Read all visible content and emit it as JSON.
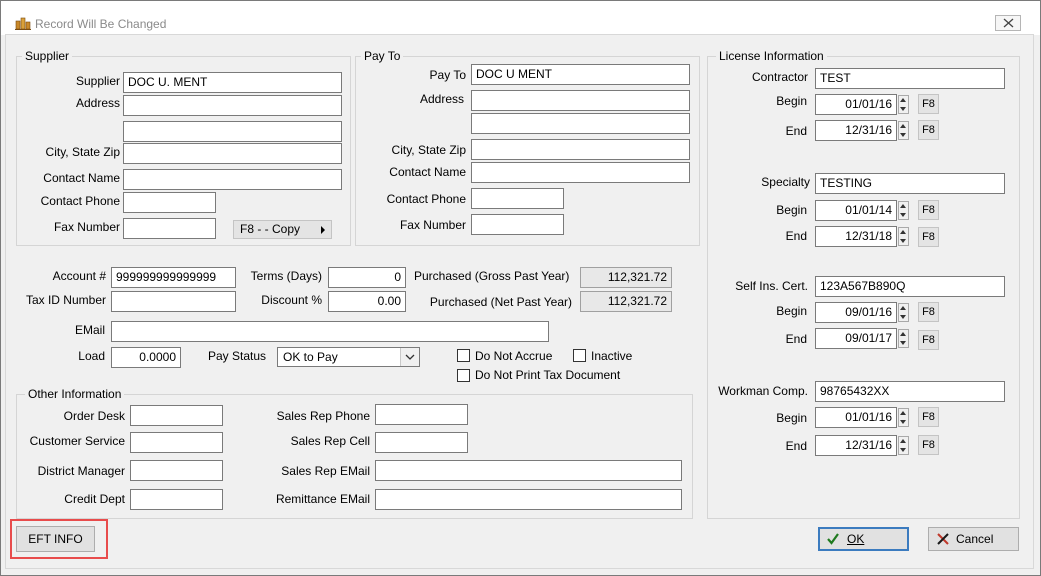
{
  "window": {
    "title": "Record Will Be Changed"
  },
  "supplier": {
    "legend": "Supplier",
    "supplier_label": "Supplier",
    "supplier_value": "DOC U. MENT",
    "address_label": "Address",
    "address1": "",
    "address2": "",
    "city_label": "City, State  Zip",
    "city_value": "",
    "contact_name_label": "Contact Name",
    "contact_name_value": "",
    "contact_phone_label": "Contact Phone",
    "contact_phone_value": "",
    "fax_label": "Fax Number",
    "fax_value": "",
    "copy_button": "F8 - - Copy"
  },
  "payto": {
    "legend": "Pay To",
    "payto_label": "Pay To",
    "payto_value": "DOC U MENT",
    "address_label": "Address",
    "address1": "",
    "address2": "",
    "city_label": "City, State  Zip",
    "city_value": "",
    "contact_name_label": "Contact Name",
    "contact_name_value": "",
    "contact_phone_label": "Contact Phone",
    "contact_phone_value": "",
    "fax_label": "Fax Number",
    "fax_value": ""
  },
  "account": {
    "account_label": "Account #",
    "account_value": "999999999999999",
    "taxid_label": "Tax ID Number",
    "taxid_value": "",
    "terms_label": "Terms (Days)",
    "terms_value": "0",
    "discount_label": "Discount %",
    "discount_value": "0.00",
    "gross_label": "Purchased (Gross Past Year)",
    "gross_value": "112,321.72",
    "net_label": "Purchased (Net Past Year)",
    "net_value": "112,321.72",
    "email_label": "EMail",
    "email_value": "",
    "load_label": "Load",
    "load_value": "0.0000",
    "paystatus_label": "Pay Status",
    "paystatus_value": "OK to Pay",
    "not_accrue_label": "Do Not Accrue",
    "inactive_label": "Inactive",
    "not_print_label": "Do Not Print Tax Document"
  },
  "other": {
    "legend": "Other Information",
    "order_desk_label": "Order Desk",
    "order_desk_value": "",
    "customer_service_label": "Customer Service",
    "customer_service_value": "",
    "district_manager_label": "District Manager",
    "district_manager_value": "",
    "credit_dept_label": "Credit Dept",
    "credit_dept_value": "",
    "sales_rep_phone_label": "Sales Rep Phone",
    "sales_rep_phone_value": "",
    "sales_rep_cell_label": "Sales Rep Cell",
    "sales_rep_cell_value": "",
    "sales_rep_email_label": "Sales Rep EMail",
    "sales_rep_email_value": "",
    "remittance_email_label": "Remittance EMail",
    "remittance_email_value": ""
  },
  "license": {
    "legend": "License Information",
    "begin_label": "Begin",
    "end_label": "End",
    "f8_label": "F8",
    "contractor_label": "Contractor",
    "contractor_value": "TEST",
    "contractor_begin": "01/01/16",
    "contractor_end": "12/31/16",
    "specialty_label": "Specialty",
    "specialty_value": "TESTING",
    "specialty_begin": "01/01/14",
    "specialty_end": "12/31/18",
    "selfins_label": "Self Ins. Cert.",
    "selfins_value": "123A567B890Q",
    "selfins_begin": "09/01/16",
    "selfins_end": "09/01/17",
    "workman_label": "Workman Comp.",
    "workman_value": "98765432XX",
    "workman_begin": "01/01/16",
    "workman_end": "12/31/16"
  },
  "buttons": {
    "eft": "EFT INFO",
    "ok": "OK",
    "cancel": "Cancel"
  },
  "colors": {
    "highlight": "#e84c4c",
    "ok_check": "#1f7a1f",
    "cancel_x": "#c0392b"
  }
}
